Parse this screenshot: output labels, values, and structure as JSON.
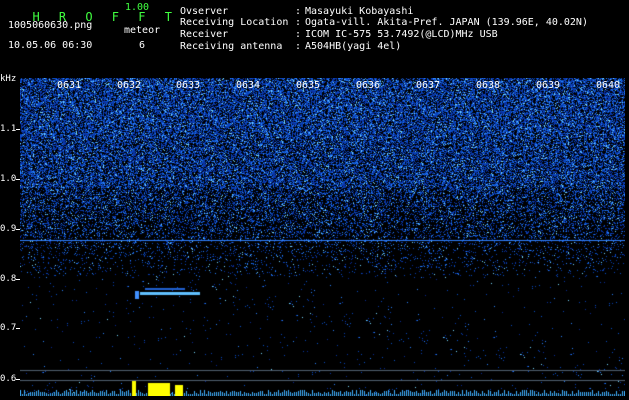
{
  "header": {
    "app_title": "HROFFT",
    "version": "1.00",
    "filename": "1005060630.png",
    "datetime": "10.05.06 06:30",
    "meteor_label": "meteor",
    "meteor_count": "6"
  },
  "info": [
    {
      "key": "Ovserver",
      "value": "Masayuki Kobayashi"
    },
    {
      "key": "Receiving Location",
      "value": "Ogata-vill. Akita-Pref. JAPAN (139.96E, 40.02N)"
    },
    {
      "key": "Receiver",
      "value": "ICOM IC-575 53.7492(@LCD)MHz USB"
    },
    {
      "key": "Receiving antenna",
      "value": "A504HB(yagi 4el)"
    }
  ],
  "axis": {
    "unit": "kHz",
    "y_ticks": [
      "1.1",
      "1.0",
      "0.9",
      "0.8",
      "0.7",
      "0.6"
    ],
    "time_ticks": [
      "0631",
      "0632",
      "0633",
      "0634",
      "0635",
      "0636",
      "0637",
      "0638",
      "0639",
      "0640"
    ]
  },
  "colors": {
    "title": "#40ff40",
    "noise_dark": "#0a1a80",
    "noise_bright": "#40b0ff",
    "line": "#3080ff",
    "bottom_peak": "#ffff00"
  }
}
